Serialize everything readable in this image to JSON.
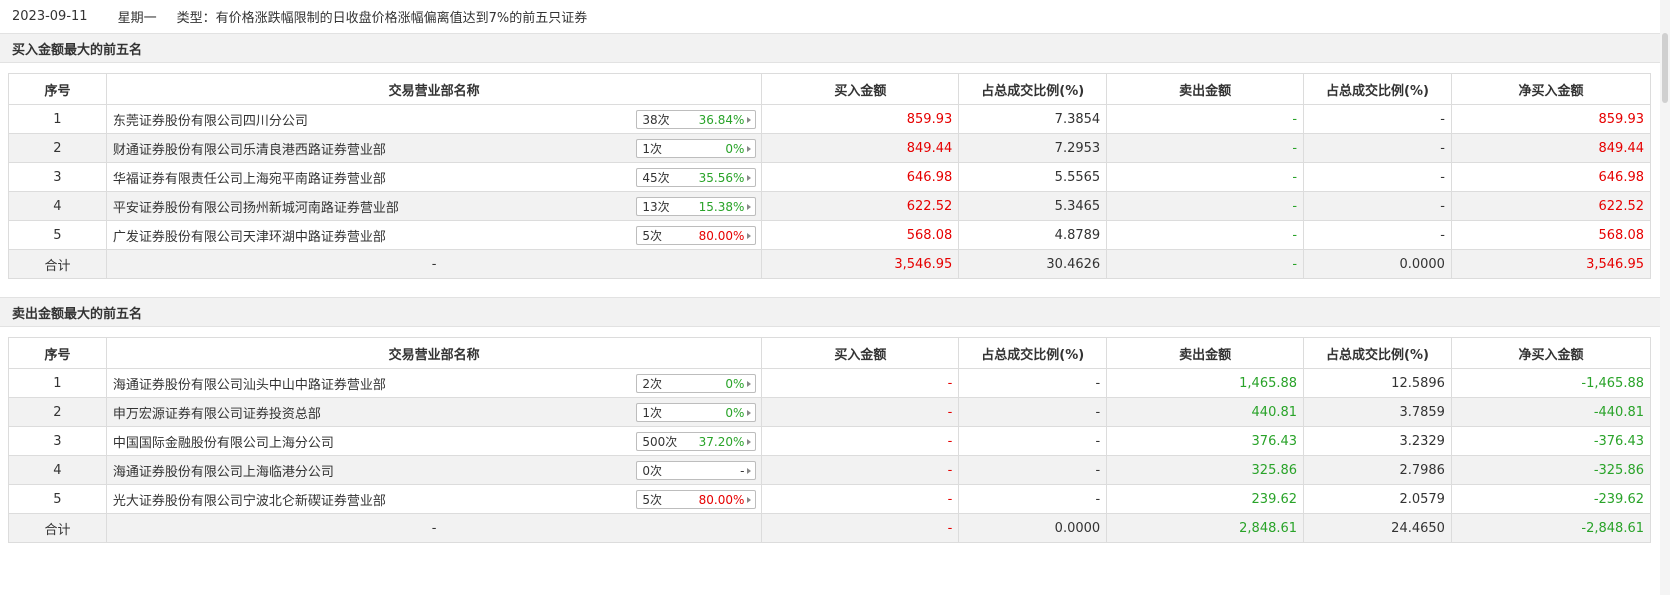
{
  "header": {
    "date": "2023-09-11",
    "weekday": "星期一",
    "type_text": "类型：有价格涨跌幅限制的日收盘价格涨幅偏离值达到7%的前五只证券"
  },
  "columns": [
    "序号",
    "交易营业部名称",
    "买入金额",
    "占总成交比例(%)",
    "卖出金额",
    "占总成交比例(%)",
    "净买入金额"
  ],
  "buy_section": {
    "title": "买入金额最大的前五名",
    "rows": [
      {
        "idx": "1",
        "name": "东莞证券股份有限公司四川分公司",
        "count": "38次",
        "rate": "36.84%",
        "rate_color": "green",
        "buy": "859.93",
        "buy_pct": "7.3854",
        "sell": "-",
        "sell_pct": "-",
        "net": "859.93"
      },
      {
        "idx": "2",
        "name": "财通证券股份有限公司乐清良港西路证券营业部",
        "count": "1次",
        "rate": "0%",
        "rate_color": "green",
        "buy": "849.44",
        "buy_pct": "7.2953",
        "sell": "-",
        "sell_pct": "-",
        "net": "849.44"
      },
      {
        "idx": "3",
        "name": "华福证券有限责任公司上海宛平南路证券营业部",
        "count": "45次",
        "rate": "35.56%",
        "rate_color": "green",
        "buy": "646.98",
        "buy_pct": "5.5565",
        "sell": "-",
        "sell_pct": "-",
        "net": "646.98"
      },
      {
        "idx": "4",
        "name": "平安证券股份有限公司扬州新城河南路证券营业部",
        "count": "13次",
        "rate": "15.38%",
        "rate_color": "green",
        "buy": "622.52",
        "buy_pct": "5.3465",
        "sell": "-",
        "sell_pct": "-",
        "net": "622.52"
      },
      {
        "idx": "5",
        "name": "广发证券股份有限公司天津环湖中路证券营业部",
        "count": "5次",
        "rate": "80.00%",
        "rate_color": "red",
        "buy": "568.08",
        "buy_pct": "4.8789",
        "sell": "-",
        "sell_pct": "-",
        "net": "568.08"
      }
    ],
    "total": {
      "label": "合计",
      "name": "-",
      "buy": "3,546.95",
      "buy_pct": "30.4626",
      "sell": "-",
      "sell_pct": "0.0000",
      "net": "3,546.95"
    }
  },
  "sell_section": {
    "title": "卖出金额最大的前五名",
    "rows": [
      {
        "idx": "1",
        "name": "海通证券股份有限公司汕头中山中路证券营业部",
        "count": "2次",
        "rate": "0%",
        "rate_color": "green",
        "buy": "-",
        "buy_pct": "-",
        "sell": "1,465.88",
        "sell_pct": "12.5896",
        "net": "-1,465.88"
      },
      {
        "idx": "2",
        "name": "申万宏源证券有限公司证券投资总部",
        "count": "1次",
        "rate": "0%",
        "rate_color": "green",
        "buy": "-",
        "buy_pct": "-",
        "sell": "440.81",
        "sell_pct": "3.7859",
        "net": "-440.81"
      },
      {
        "idx": "3",
        "name": "中国国际金融股份有限公司上海分公司",
        "count": "500次",
        "rate": "37.20%",
        "rate_color": "green",
        "buy": "-",
        "buy_pct": "-",
        "sell": "376.43",
        "sell_pct": "3.2329",
        "net": "-376.43"
      },
      {
        "idx": "4",
        "name": "海通证券股份有限公司上海临港分公司",
        "count": "0次",
        "rate": "-",
        "rate_color": "gray",
        "buy": "-",
        "buy_pct": "-",
        "sell": "325.86",
        "sell_pct": "2.7986",
        "net": "-325.86"
      },
      {
        "idx": "5",
        "name": "光大证券股份有限公司宁波北仑新碶证券营业部",
        "count": "5次",
        "rate": "80.00%",
        "rate_color": "red",
        "buy": "-",
        "buy_pct": "-",
        "sell": "239.62",
        "sell_pct": "2.0579",
        "net": "-239.62"
      }
    ],
    "total": {
      "label": "合计",
      "name": "-",
      "buy": "-",
      "buy_pct": "0.0000",
      "sell": "2,848.61",
      "sell_pct": "24.4650",
      "net": "-2,848.61"
    }
  },
  "colors": {
    "up": "#e60000",
    "down": "#29a329",
    "header_bg": "#f2f2f2",
    "border": "#dcdcdc"
  }
}
